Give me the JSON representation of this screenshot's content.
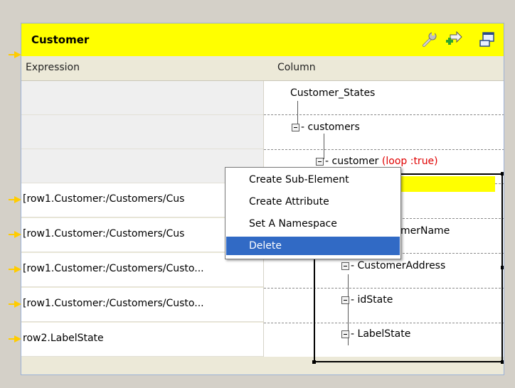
{
  "panel": {
    "title": "Customer",
    "header_color": "#ffff00",
    "icons": [
      "wrench-icon",
      "add-output-icon",
      "minimize-icon"
    ]
  },
  "columns": {
    "expression": "Expression",
    "column": "Column"
  },
  "expressions": [
    "",
    "",
    "",
    "[row1.Customer:/Customers/Cus",
    "[row1.Customer:/Customers/Cus",
    "[row1.Customer:/Customers/Custo...",
    "[row1.Customer:/Customers/Custo...",
    "row2.LabelState"
  ],
  "tree": {
    "root": "Customer_States",
    "customers": "customers",
    "customer": "customer",
    "loop_tag": "(loop :true)",
    "customer_name": "CustomerName",
    "customer_name_visible": "merName",
    "customer_address": "CustomerAddress",
    "id_state": "idState",
    "label_state": "LabelState"
  },
  "context_menu": {
    "items": [
      "Create Sub-Element",
      "Create Attribute",
      "Set A Namespace",
      "Delete"
    ],
    "selected": "Delete",
    "selected_color": "#316ac5"
  }
}
